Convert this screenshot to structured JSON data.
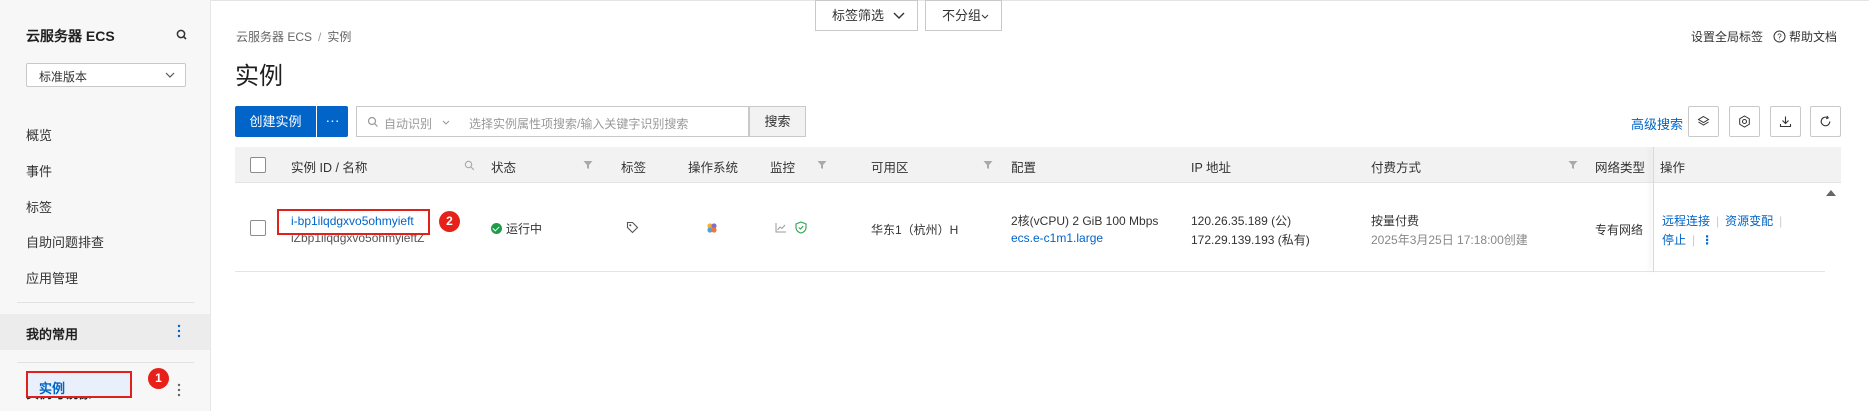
{
  "sidebar": {
    "title": "云服务器 ECS",
    "version_select": "标准版本",
    "items": [
      "概览",
      "事件",
      "标签",
      "自助问题排查",
      "应用管理"
    ],
    "groups": [
      "我的常用",
      "实例与镜像"
    ],
    "active_item": "实例",
    "marker_1": "1"
  },
  "header": {
    "breadcrumb": [
      "云服务器 ECS",
      "实例"
    ],
    "title": "实例",
    "global_tags": "设置全局标签",
    "help_docs": "帮助文档"
  },
  "toolbar": {
    "create_label": "创建实例",
    "more_label": "···",
    "search_mode": "自动识别",
    "search_placeholder": "选择实例属性项搜索/输入关键字识别搜索",
    "search_label": "搜索",
    "tag_filter_label": "标签筛选",
    "group_label": "不分组",
    "advanced_search": "高级搜索"
  },
  "table": {
    "headers": {
      "id_name": "实例 ID / 名称",
      "status": "状态",
      "tags": "标签",
      "os": "操作系统",
      "monitor": "监控",
      "zone": "可用区",
      "config": "配置",
      "ip": "IP 地址",
      "billing": "付费方式",
      "network": "网络类型",
      "ops": "操作"
    },
    "rows": [
      {
        "id": "i-bp1ilqdgxvo5ohmyieft",
        "name": "iZbp1ilqdgxvo5ohmyieftZ",
        "status": "运行中",
        "zone": "华东1（杭州）H",
        "config_line1": "2核(vCPU)  2 GiB 100 Mbps",
        "config_line2": "ecs.e-c1m1.large",
        "ip_public": "120.26.35.189 (公)",
        "ip_private": "172.29.139.193 (私有)",
        "billing": "按量付费",
        "created": "2025年3月25日 17:18:00创建",
        "network": "专有网络",
        "op_remote": "远程连接",
        "op_change": "资源变配",
        "op_stop": "停止",
        "op_more": "⋮",
        "marker_2": "2"
      }
    ]
  }
}
